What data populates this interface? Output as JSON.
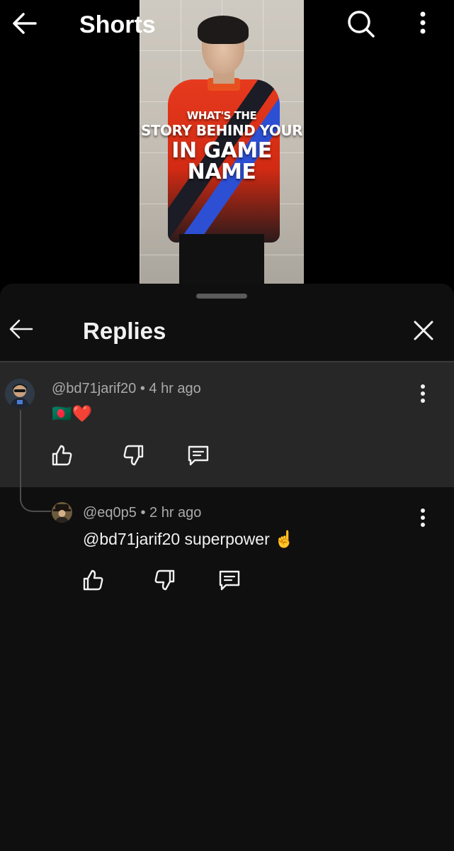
{
  "top_bar": {
    "title": "Shorts"
  },
  "video": {
    "overlay_line1": "WHAT'S THE",
    "overlay_line2": "STORY BEHIND YOUR",
    "overlay_line3": "IN GAME NAME"
  },
  "sheet": {
    "title": "Replies"
  },
  "comments": [
    {
      "meta": "@bd71jarif20 • 4 hr ago",
      "text": "🇧🇩❤️"
    },
    {
      "meta": "@eq0p5 • 2 hr ago",
      "text": "@bd71jarif20 superpower ☝️"
    }
  ],
  "icons": {
    "back": "arrow-left-icon",
    "search": "search-icon",
    "more": "more-vert-icon",
    "close": "close-icon",
    "like": "thumbs-up-icon",
    "dislike": "thumbs-down-icon",
    "reply": "comment-icon"
  },
  "colors": {
    "sheet_bg": "#0f0f0f",
    "highlight_bg": "#272727",
    "meta_text": "#aaaaaa"
  }
}
